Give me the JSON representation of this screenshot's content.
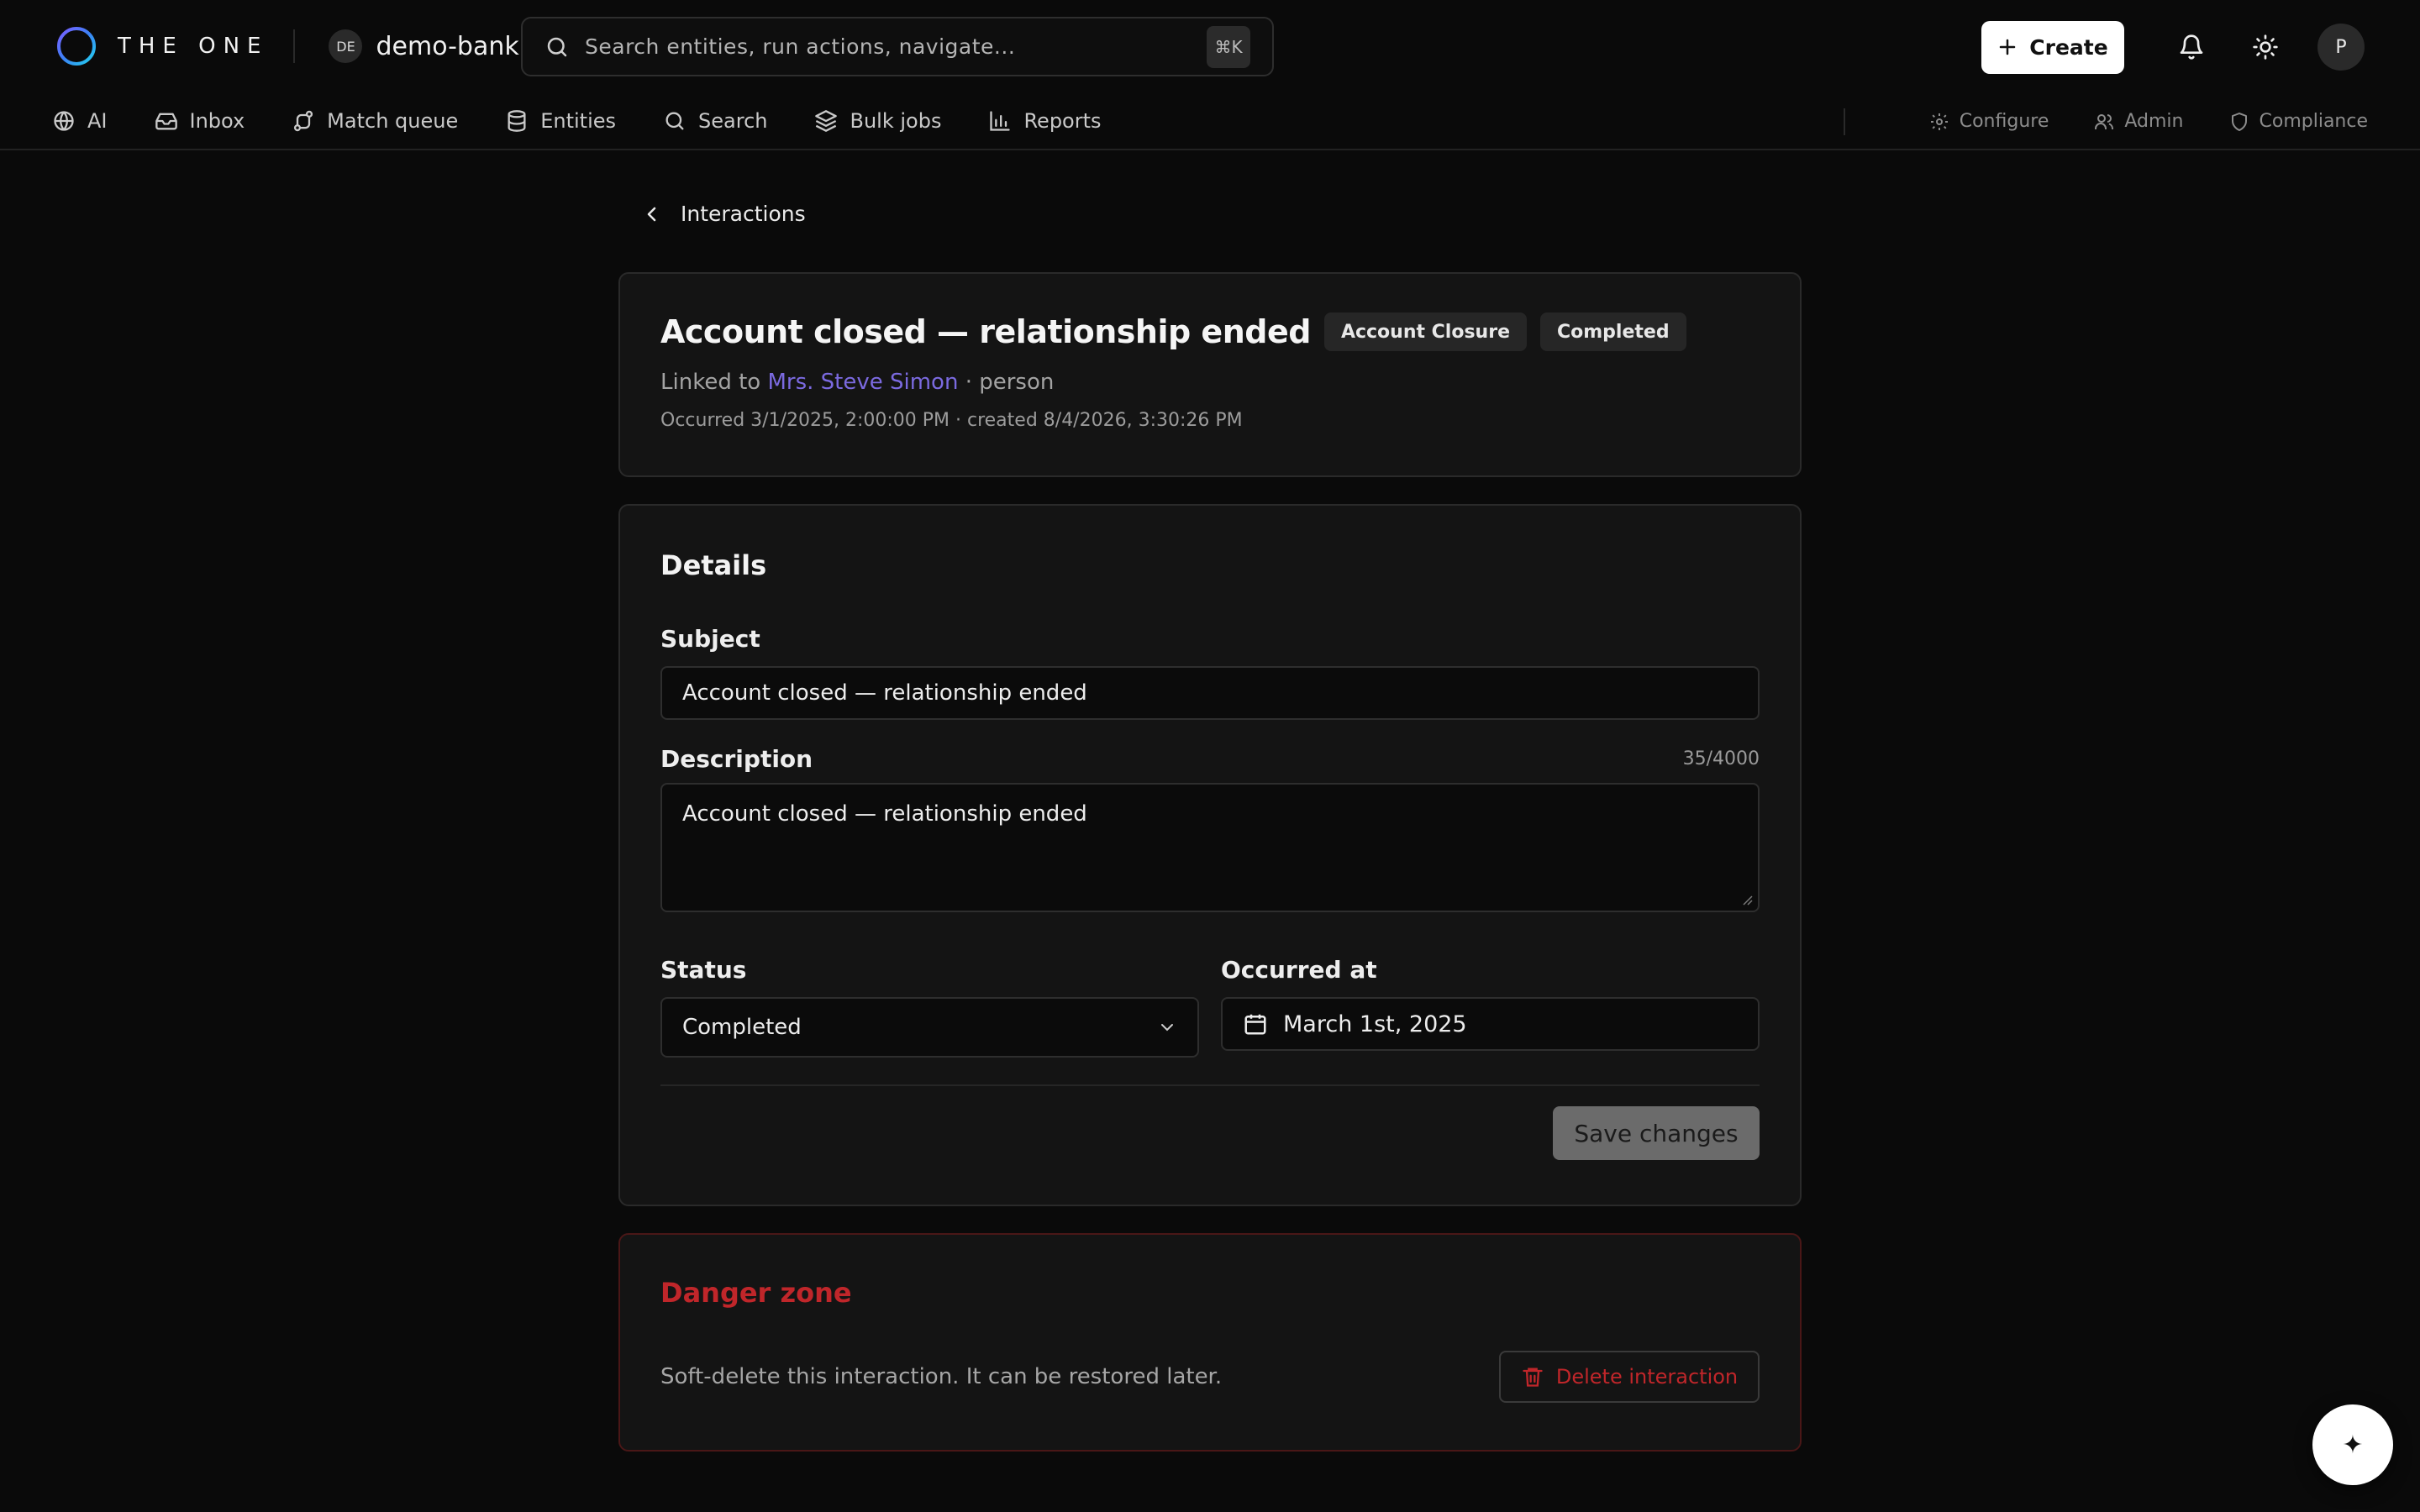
{
  "brand": {
    "name": "THE ONE"
  },
  "tenant": {
    "badge": "DE",
    "name": "demo-bank"
  },
  "search": {
    "placeholder": "Search entities, run actions, navigate...",
    "shortcut": "⌘K"
  },
  "header": {
    "create_label": "Create",
    "avatar_initial": "P"
  },
  "nav": {
    "items": [
      {
        "label": "AI",
        "icon": "globe-icon"
      },
      {
        "label": "Inbox",
        "icon": "inbox-icon"
      },
      {
        "label": "Match queue",
        "icon": "route-icon"
      },
      {
        "label": "Entities",
        "icon": "database-icon"
      },
      {
        "label": "Search",
        "icon": "search-icon"
      },
      {
        "label": "Bulk jobs",
        "icon": "layers-icon"
      },
      {
        "label": "Reports",
        "icon": "bar-chart-icon"
      }
    ],
    "secondary": [
      {
        "label": "Configure",
        "icon": "gear-icon"
      },
      {
        "label": "Admin",
        "icon": "users-icon"
      },
      {
        "label": "Compliance",
        "icon": "shield-icon"
      }
    ]
  },
  "breadcrumb": {
    "back_label": "Interactions"
  },
  "interaction": {
    "title": "Account closed — relationship ended",
    "type_badge": "Account Closure",
    "status_badge": "Completed",
    "linked_prefix": "Linked to",
    "linked_name": "Mrs. Steve Simon",
    "linked_suffix": "· person",
    "meta": "Occurred 3/1/2025, 2:00:00 PM · created 8/4/2026, 3:30:26 PM"
  },
  "details": {
    "title": "Details",
    "subject_label": "Subject",
    "subject_value": "Account closed — relationship ended",
    "description_label": "Description",
    "description_counter": "35/4000",
    "description_value": "Account closed — relationship ended",
    "status_label": "Status",
    "status_value": "Completed",
    "occurred_label": "Occurred at",
    "occurred_value": "March 1st, 2025",
    "save_label": "Save changes"
  },
  "danger": {
    "title": "Danger zone",
    "text": "Soft-delete this interaction. It can be restored later.",
    "delete_label": "Delete interaction"
  },
  "fab": {
    "glyph": "✦"
  },
  "colors": {
    "accent_link": "#7b6ae0",
    "danger": "#c0262a",
    "background": "#0a0a0a",
    "card": "#141414"
  }
}
